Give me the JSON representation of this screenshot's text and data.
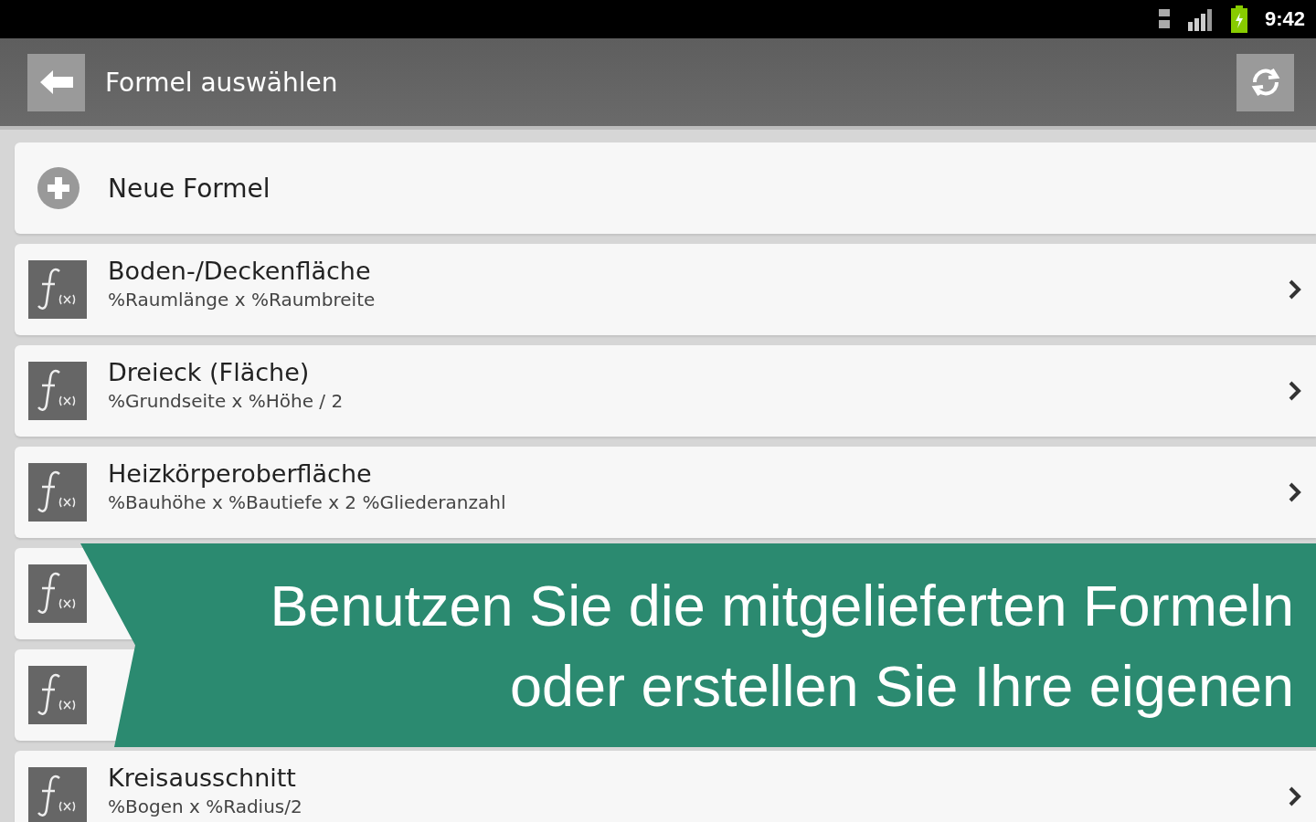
{
  "status_bar": {
    "time": "9:42"
  },
  "action_bar": {
    "title": "Formel auswählen"
  },
  "new_item": {
    "label": "Neue Formel"
  },
  "formulas": [
    {
      "kind": "formula",
      "title": "Boden-/Deckenfläche",
      "formula": "%Raumlänge x %Raumbreite"
    },
    {
      "kind": "formula",
      "title": "Dreieck (Fläche)",
      "formula": "%Grundseite x %Höhe / 2"
    },
    {
      "kind": "formula",
      "title": "Heizkörperoberfläche",
      "formula": "%Bauhöhe x %Bautiefe x 2 %Gliederanzahl"
    },
    {
      "kind": "covered"
    },
    {
      "kind": "covered"
    },
    {
      "kind": "formula",
      "title": "Kreisausschnitt",
      "formula": "%Bogen x %Radius/2"
    }
  ],
  "banner": {
    "lines": [
      "Benutzen Sie die mitgelieferten Formeln",
      "oder erstellen Sie Ihre eigenen"
    ]
  }
}
